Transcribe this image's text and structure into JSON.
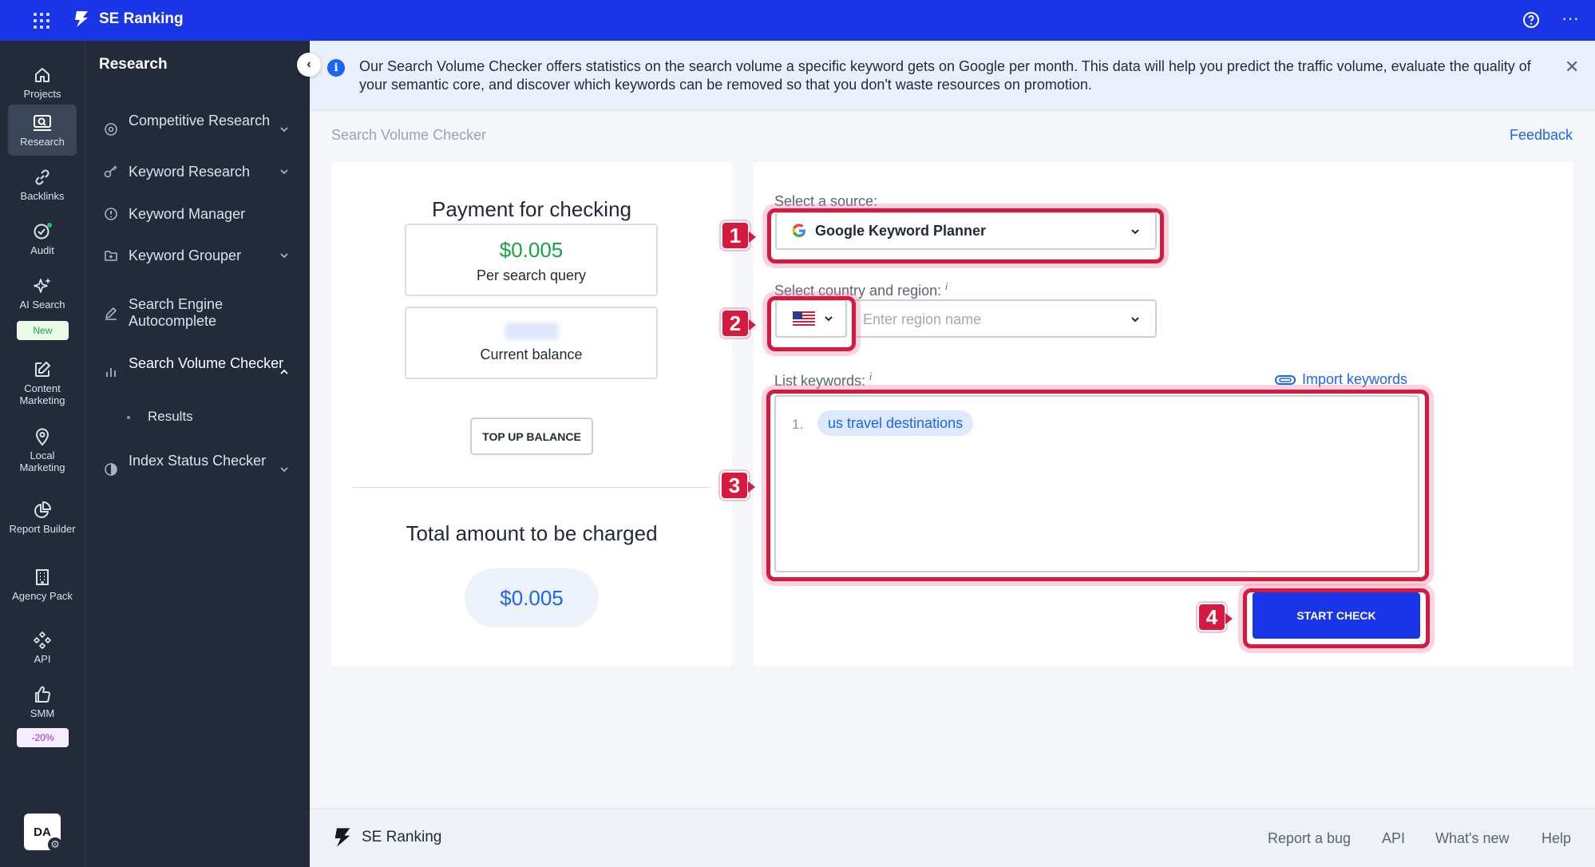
{
  "app": {
    "name": "SE Ranking"
  },
  "rail": {
    "items": [
      {
        "label": "Projects",
        "icon": "home-icon"
      },
      {
        "label": "Research",
        "icon": "research-icon"
      },
      {
        "label": "Backlinks",
        "icon": "link-icon"
      },
      {
        "label": "Audit",
        "icon": "audit-icon"
      },
      {
        "label": "AI Search",
        "icon": "sparkle-icon",
        "badge": "New"
      },
      {
        "label": "Content Marketing",
        "icon": "edit-icon"
      },
      {
        "label": "Local Marketing",
        "icon": "location-pin-icon"
      },
      {
        "label": "Report Builder",
        "icon": "pie-chart-icon"
      },
      {
        "label": "Agency Pack",
        "icon": "building-icon"
      },
      {
        "label": "API",
        "icon": "api-icon"
      },
      {
        "label": "SMM",
        "icon": "thumbs-up-icon",
        "badge": "-20%"
      }
    ],
    "avatar": "DA"
  },
  "sidebar": {
    "title": "Research",
    "items": [
      {
        "label": "Competitive Research",
        "icon": "target-icon"
      },
      {
        "label": "Keyword Research",
        "icon": "key-icon"
      },
      {
        "label": "Keyword Manager",
        "icon": "clock-icon"
      },
      {
        "label": "Keyword Grouper",
        "icon": "folder-icon"
      },
      {
        "label": "Search Engine Autocomplete",
        "icon": "pencil-icon"
      },
      {
        "label": "Search Volume Checker",
        "icon": "bar-chart-icon",
        "sub": [
          "Results"
        ]
      },
      {
        "label": "Index Status Checker",
        "icon": "index-icon"
      }
    ]
  },
  "banner": {
    "text": "Our Search Volume Checker offers statistics on the search volume a specific keyword gets on Google per month. This data will help you predict the traffic volume, evaluate the quality of your semantic core, and discover which keywords can be removed so that you don't waste resources on promotion."
  },
  "page": {
    "breadcrumb": "Search Volume Checker",
    "feedback": "Feedback"
  },
  "payment": {
    "title": "Payment for checking",
    "price_value": "$0.005",
    "price_caption": "Per search query",
    "balance_caption": "Current balance",
    "topup_label": "TOP UP BALANCE",
    "total_title": "Total amount to be charged",
    "total_value": "$0.005"
  },
  "form": {
    "source_label": "Select a source:",
    "source_value": "Google Keyword Planner",
    "country_label": "Select country and region:",
    "info_mark": "i",
    "region_placeholder": "Enter region name",
    "keywords_label": "List keywords:",
    "import_label": "Import keywords",
    "keyword_number": "1.",
    "keyword": "us travel destinations",
    "start_label": "START CHECK"
  },
  "annotations": [
    "1",
    "2",
    "3",
    "4"
  ],
  "footer": {
    "brand": "SE Ranking",
    "links": [
      "Report a bug",
      "API",
      "What's new",
      "Help"
    ]
  },
  "colors": {
    "brand_blue": "#1a35e8",
    "rail_bg": "#232b3b",
    "price_green": "#17a34a",
    "link_blue": "#1c64f2",
    "highlight_red": "#d7193f"
  }
}
